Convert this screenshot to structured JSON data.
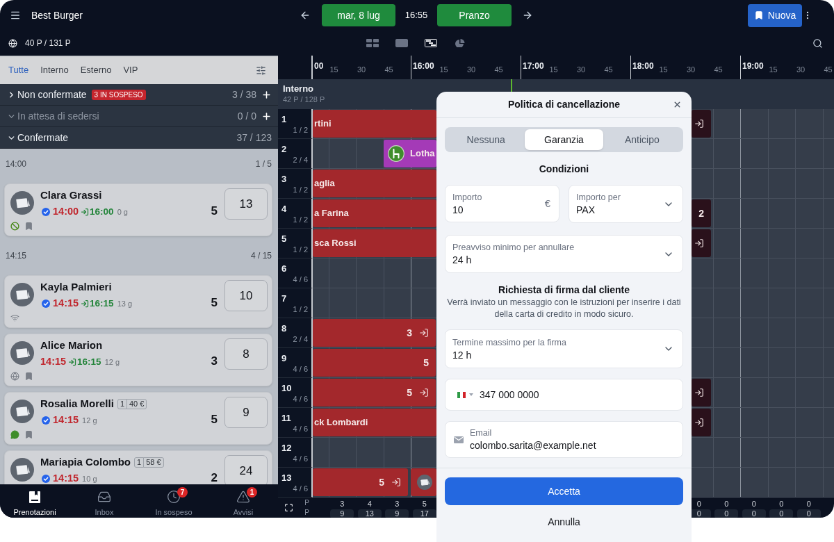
{
  "top_bar": {
    "restaurant": "Best Burger",
    "date": "mar, 8 lug",
    "time": "16:55",
    "service": "Pranzo",
    "new_button": "Nuova"
  },
  "sub_bar": {
    "covers": "40 P / 131 P",
    "views": [
      {
        "kind": "list",
        "selected": false
      },
      {
        "kind": "floor",
        "selected": false
      },
      {
        "kind": "timeline",
        "selected": true
      },
      {
        "kind": "stats",
        "selected": false
      }
    ]
  },
  "filters": [
    {
      "label": "Tutte",
      "selected": true
    },
    {
      "label": "Interno",
      "selected": false
    },
    {
      "label": "Esterno",
      "selected": false
    },
    {
      "label": "VIP",
      "selected": false
    }
  ],
  "sections": [
    {
      "title": "Non confermate",
      "badge": "3 IN SOSPESO",
      "count": "3 / 38",
      "expanded": false,
      "disabled": false,
      "add": true
    },
    {
      "title": "In attesa di sedersi",
      "count": "0 / 0",
      "expanded": true,
      "disabled": true,
      "add": true
    },
    {
      "title": "Confermate",
      "count": "37 / 123",
      "expanded": true,
      "disabled": false,
      "add": false
    }
  ],
  "groups": [
    {
      "time": "14:00",
      "count": "1 / 5",
      "reservations": [
        {
          "name": "Clara Grassi",
          "verified": true,
          "start": "14:00",
          "end": "16:00",
          "age": "0 g",
          "party": "5",
          "table": "13",
          "markers": [
            {
              "kind": "ban"
            },
            {
              "kind": "bookmark"
            }
          ]
        }
      ]
    },
    {
      "time": "14:15",
      "count": "4 / 15",
      "reservations": [
        {
          "name": "Kayla Palmieri",
          "verified": true,
          "start": "14:15",
          "end": "16:15",
          "age": "13 g",
          "party": "5",
          "table": "10",
          "markers": [
            {
              "kind": "wifi"
            }
          ]
        },
        {
          "name": "Alice Marion",
          "verified": false,
          "start": "14:15",
          "end": "16:15",
          "age": "12 g",
          "party": "3",
          "table": "8",
          "markers": [
            {
              "kind": "globe"
            },
            {
              "kind": "bookmark"
            }
          ]
        },
        {
          "name": "Rosalia Morelli",
          "tags": [
            "1",
            "40 €"
          ],
          "verified": true,
          "start": "14:15",
          "age": "12 g",
          "party": "5",
          "table": "9",
          "markers": [
            {
              "kind": "chat"
            },
            {
              "kind": "bookmark"
            }
          ]
        },
        {
          "name": "Mariapia Colombo",
          "tags": [
            "1",
            "58 €"
          ],
          "verified": true,
          "start": "14:15",
          "age": "10 g",
          "party": "2",
          "table": "24"
        }
      ]
    }
  ],
  "bottom_nav": [
    {
      "kind": "bookings",
      "label": "Prenotazioni",
      "selected": true
    },
    {
      "kind": "inbox",
      "label": "Inbox",
      "selected": false
    },
    {
      "kind": "pending",
      "label": "In sospeso",
      "selected": false,
      "badge": "7"
    },
    {
      "kind": "alerts",
      "label": "Avvisi",
      "selected": false,
      "badge": "1"
    }
  ],
  "timeline": {
    "ticks": [
      "00",
      "15",
      "30",
      "45",
      "16:00",
      "15",
      "30",
      "45",
      "17:00",
      "15",
      "30",
      "45",
      "18:00",
      "15",
      "30",
      "45",
      "19:00",
      "15",
      "30",
      "45"
    ],
    "area": {
      "name": "Interno",
      "covers": "42 P / 128 P"
    },
    "rows": [
      {
        "table": "1",
        "capacity": "1 / 2",
        "blocks": [
          {
            "color": "#a3282c",
            "kind": "plain",
            "name": "rtini",
            "arrived": false
          },
          {
            "color": "#2a111b",
            "kind": "plain",
            "arrived": true
          }
        ]
      },
      {
        "table": "2",
        "capacity": "2 / 4",
        "blocks": [
          {
            "color": "#a43ab7",
            "kind": "seated",
            "name": "Lotha",
            "arrived": false
          }
        ]
      },
      {
        "table": "3",
        "capacity": "1 / 2",
        "blocks": [
          {
            "color": "#a3282c",
            "kind": "plain",
            "name": "aglia",
            "arrived": false
          }
        ]
      },
      {
        "table": "4",
        "capacity": "1 / 2",
        "blocks": [
          {
            "color": "#a3282c",
            "kind": "plain",
            "name": "a Farina",
            "arrived": false
          },
          {
            "color": "#2a111b",
            "kind": "plain",
            "party": "2",
            "arrived": false
          }
        ]
      },
      {
        "table": "5",
        "capacity": "1 / 2",
        "blocks": [
          {
            "color": "#a3282c",
            "kind": "plain",
            "name": "sca Rossi",
            "arrived": false
          },
          {
            "color": "#2a111b",
            "kind": "plain",
            "arrived": true
          }
        ]
      },
      {
        "table": "6",
        "capacity": "4 / 6"
      },
      {
        "table": "7",
        "capacity": "1 / 2"
      },
      {
        "table": "8",
        "capacity": "2 / 4",
        "blocks": [
          {
            "color": "#a3282c",
            "kind": "plain",
            "party": "3",
            "arrived": true
          }
        ]
      },
      {
        "table": "9",
        "capacity": "4 / 6",
        "blocks": [
          {
            "color": "#a3282c",
            "kind": "plain",
            "party": "5",
            "arrived": false
          }
        ]
      },
      {
        "table": "10",
        "capacity": "4 / 6",
        "blocks": [
          {
            "color": "#a3282c",
            "kind": "plain",
            "party": "5",
            "arrived": true
          },
          {
            "color": "#2a111b",
            "kind": "plain",
            "arrived": true
          }
        ]
      },
      {
        "table": "11",
        "capacity": "4 / 6",
        "blocks": [
          {
            "color": "#a3282c",
            "kind": "plain",
            "name": "ck Lombardi",
            "arrived": false
          },
          {
            "color": "#2a111b",
            "kind": "plain",
            "arrived": true
          }
        ]
      },
      {
        "table": "12",
        "capacity": "4 / 6"
      },
      {
        "table": "13",
        "capacity": "4 / 6",
        "blocks": [
          {
            "color": "#a3282c",
            "kind": "plain",
            "party": "5",
            "arrived": true
          },
          {
            "color": "#a3282c",
            "kind": "app",
            "arrived": false
          }
        ]
      }
    ],
    "footer": {
      "labels": [
        "P",
        "P"
      ],
      "columns": [
        {
          "covers": "3",
          "tables": "9"
        },
        {
          "covers": "4",
          "tables": "13"
        },
        {
          "covers": "3",
          "tables": "9"
        },
        {
          "covers": "5",
          "tables": "17"
        },
        {
          "covers": "0",
          "tables": "0"
        },
        {
          "covers": "0",
          "tables": "0"
        },
        {
          "covers": "0",
          "tables": "0"
        },
        {
          "covers": "0",
          "tables": "0"
        },
        {
          "covers": "0",
          "tables": "0"
        }
      ]
    }
  },
  "dialog": {
    "title": "Politica di cancellazione",
    "options": [
      {
        "label": "Nessuna",
        "selected": false
      },
      {
        "label": "Garanzia",
        "selected": true
      },
      {
        "label": "Anticipo",
        "selected": false
      }
    ],
    "conditions_heading": "Condizioni",
    "amount": {
      "label": "Importo",
      "value": "10",
      "unit": "€"
    },
    "amount_per": {
      "label": "Importo per",
      "value": "PAX"
    },
    "notice": {
      "label": "Preavviso minimo per annullare",
      "value": "24 h"
    },
    "signature_heading": "Richiesta di firma dal cliente",
    "signature_note": "Verrà inviato un messaggio con le istruzioni per inserire i dati della carta di credito in modo sicuro.",
    "deadline": {
      "label": "Termine massimo per la firma",
      "value": "12 h"
    },
    "phone": {
      "value": "347 000 0000"
    },
    "email": {
      "label": "Email",
      "value": "colombo.sarita@example.net"
    },
    "accept": "Accetta",
    "cancel": "Annulla"
  }
}
